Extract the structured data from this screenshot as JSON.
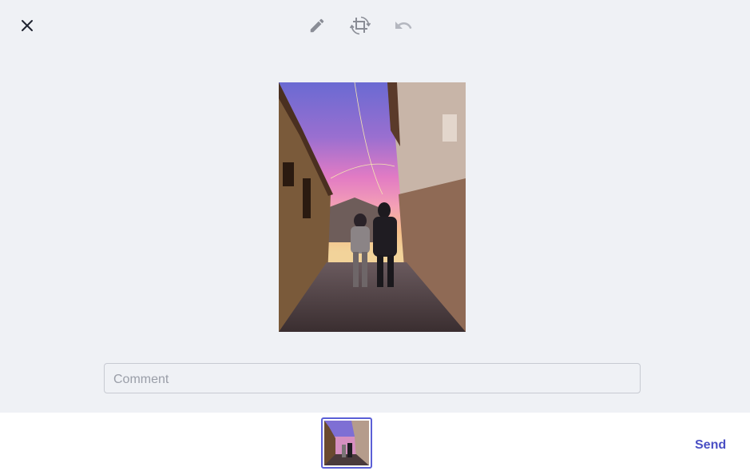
{
  "header": {
    "close_icon": "close-icon",
    "tools": [
      {
        "name": "edit",
        "icon": "pencil-icon"
      },
      {
        "name": "crop",
        "icon": "crop-rotate-icon"
      },
      {
        "name": "undo",
        "icon": "undo-icon"
      }
    ]
  },
  "comment": {
    "placeholder": "Comment",
    "value": ""
  },
  "footer": {
    "send_label": "Send",
    "accent_color": "#4a4fc4",
    "thumbnail_selected": true
  }
}
